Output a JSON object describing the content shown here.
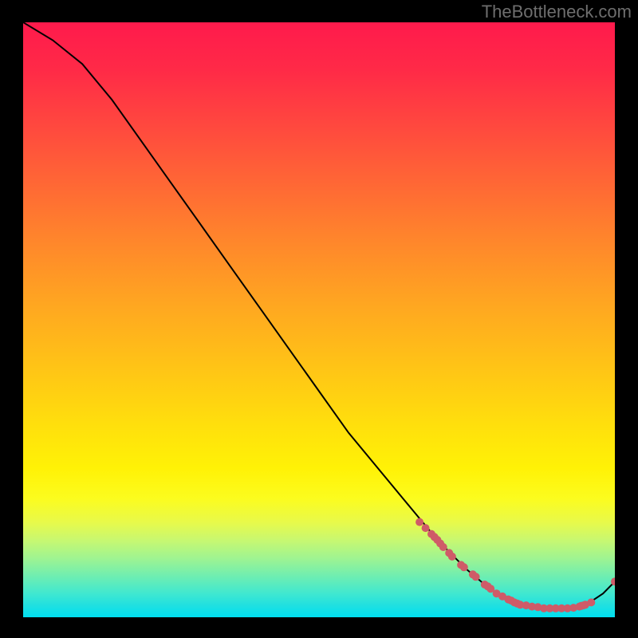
{
  "watermark": "TheBottleneck.com",
  "chart_data": {
    "type": "line",
    "title": "",
    "xlabel": "",
    "ylabel": "",
    "xlim": [
      0,
      100
    ],
    "ylim": [
      0,
      100
    ],
    "curve": {
      "x": [
        0,
        5,
        10,
        15,
        20,
        25,
        30,
        35,
        40,
        45,
        50,
        55,
        60,
        65,
        70,
        72,
        75,
        78,
        80,
        82,
        85,
        88,
        90,
        92,
        95,
        98,
        100
      ],
      "y": [
        100,
        97,
        93,
        87,
        80,
        73,
        66,
        59,
        52,
        45,
        38,
        31,
        25,
        19,
        13,
        11,
        8,
        5.5,
        4,
        3,
        2,
        1.5,
        1.5,
        1.5,
        2,
        4,
        6
      ]
    },
    "highlight_points": {
      "x": [
        67,
        68,
        69,
        69.5,
        70,
        70.5,
        71,
        72,
        72.5,
        74,
        74.5,
        76,
        76.5,
        78,
        78.5,
        79,
        80,
        81,
        82,
        82.5,
        83,
        83.5,
        84,
        85,
        86,
        87,
        88,
        89,
        90,
        91,
        92,
        93,
        94,
        94.3,
        94.7,
        95,
        96,
        100
      ],
      "y": [
        16,
        15,
        14,
        13.5,
        13,
        12.4,
        11.8,
        10.8,
        10.2,
        8.8,
        8.4,
        7.2,
        6.8,
        5.5,
        5.2,
        4.8,
        4,
        3.5,
        3,
        2.8,
        2.5,
        2.3,
        2.1,
        2,
        1.8,
        1.7,
        1.5,
        1.5,
        1.5,
        1.5,
        1.5,
        1.6,
        1.8,
        1.9,
        2.0,
        2.1,
        2.5,
        6
      ],
      "color": "#cf5b68",
      "radius": 5
    },
    "gradient_stops": [
      {
        "pos": 0,
        "color": "#ff1a4c"
      },
      {
        "pos": 50,
        "color": "#ffb818"
      },
      {
        "pos": 80,
        "color": "#fff808"
      },
      {
        "pos": 100,
        "color": "#00dff0"
      }
    ]
  }
}
